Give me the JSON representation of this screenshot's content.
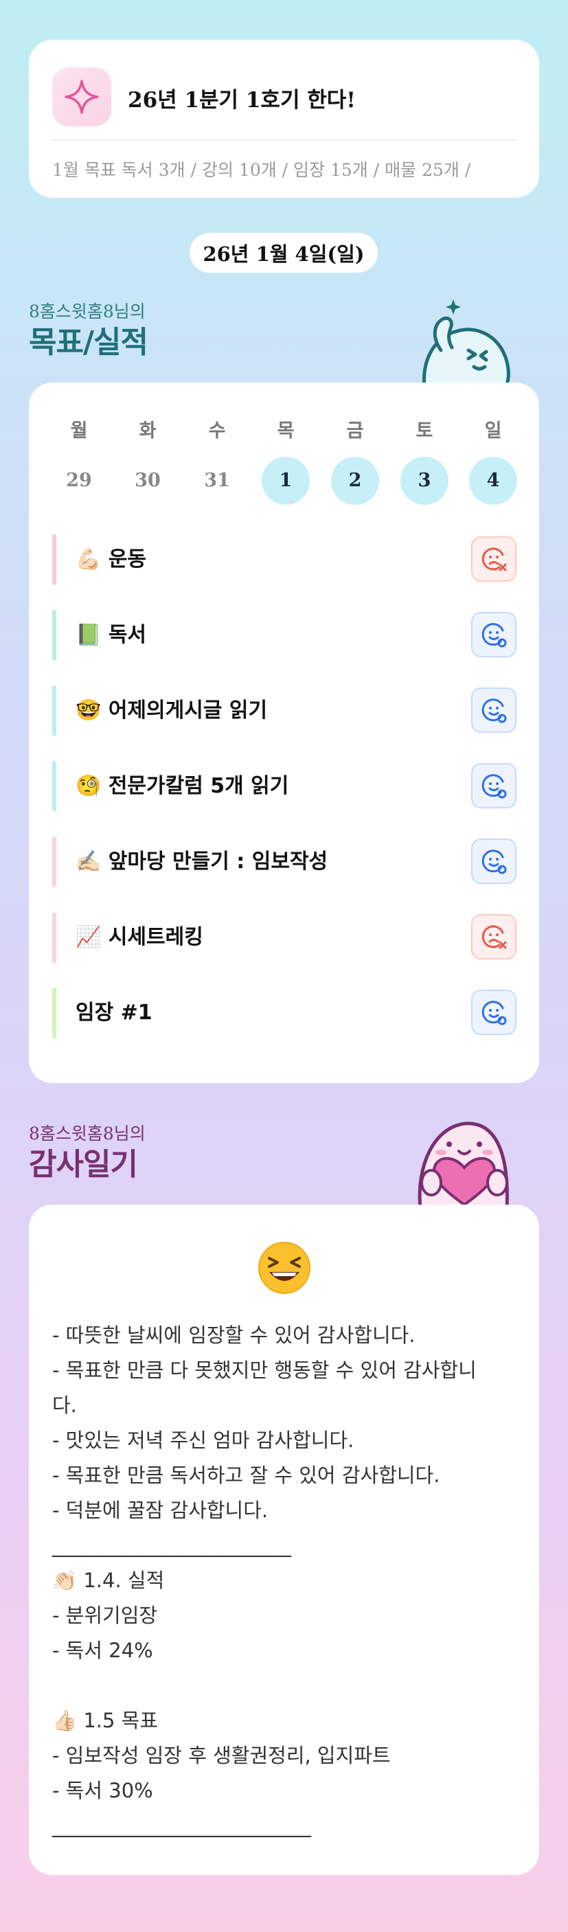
{
  "goal_header": {
    "title": "26년 1분기 1호기 한다!",
    "monthly_goal": "1월 목표  독서 3개 / 강의 10개 / 임장 15개 / 매물 25개 /"
  },
  "date_label": "26년 1월 4일(일)",
  "goals_section": {
    "owner": "8홈스윗홈8님의",
    "title": "목표/실적"
  },
  "week": {
    "weekdays": [
      "월",
      "화",
      "수",
      "목",
      "금",
      "토",
      "일"
    ],
    "days": [
      "29",
      "30",
      "31",
      "1",
      "2",
      "3",
      "4"
    ],
    "active": [
      false,
      false,
      false,
      true,
      true,
      true,
      true
    ]
  },
  "goals": [
    {
      "emoji": "💪🏻",
      "label": "운동",
      "status": "fail",
      "bar_color": "#f9c8dc"
    },
    {
      "emoji": "📗",
      "label": "독서",
      "status": "done",
      "bar_color": "#b9efd9"
    },
    {
      "emoji": "🤓",
      "label": "어제의게시글 읽기",
      "status": "done",
      "bar_color": "#bdeef0"
    },
    {
      "emoji": "🧐",
      "label": "전문가칼럼 5개 읽기",
      "status": "done",
      "bar_color": "#bdeef0"
    },
    {
      "emoji": "✍🏻",
      "label": "앞마당 만들기 : 임보작성",
      "status": "done",
      "bar_color": "#fbd3dc"
    },
    {
      "emoji": "📈",
      "label": "시세트레킹",
      "status": "fail",
      "bar_color": "#fbd3dc"
    },
    {
      "emoji": "",
      "label": "임장 #1",
      "status": "done",
      "bar_color": "#d6f2b8"
    }
  ],
  "diary_section": {
    "owner": "8홈스윗홈8님의",
    "title": "감사일기",
    "mood_icon": "laughing-face",
    "text": "- 따뜻한 날씨에 임장할 수 있어 감사합니다.\n- 목표한 만큼 다 못했지만 행동할 수 있어 감사합니\n다.\n- 맛있는 저녁 주신 엄마 감사합니다.\n- 목표한 만큼 독서하고 잘 수 있어 감사합니다.\n- 덕분에 꿀잠 감사합니다.\n________________________\n👏🏻 1.4. 실적\n- 분위기임장\n- 독서 24%\n\n👍🏻 1.5 목표\n- 임보작성 임장 후 생활권정리, 입지파트\n- 독서 30%\n__________________________"
  },
  "colors": {
    "accent_teal": "#1f6f79",
    "accent_purple": "#7a2f72",
    "done_icon": "#2f6fe6",
    "fail_icon": "#e8564a"
  }
}
